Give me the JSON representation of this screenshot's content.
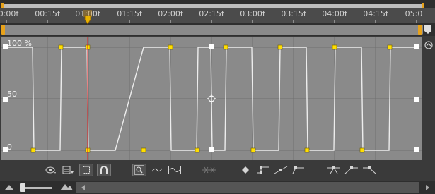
{
  "ruler": {
    "labels": [
      "0:00f",
      "00:15f",
      "01:00f",
      "01:15f",
      "02:00f",
      "02:15f",
      "03:00f",
      "03:15f",
      "04:00f",
      "04:15f",
      "05:0"
    ]
  },
  "graph": {
    "y_labels": {
      "top": "100 %",
      "mid": "50",
      "bottom": "0"
    },
    "colors": {
      "curve": "#e9e9e9",
      "keyframe": "#ffde00",
      "cti": "#e02020",
      "grid": "#6f6f6f",
      "background": "#8a8a8a"
    }
  },
  "toolbar": {
    "icons": [
      "eye-visibility-icon",
      "graph-type-options-icon",
      "transform-box-icon",
      "snap-magnet-icon",
      "fit-selection-icon",
      "fit-all-graphs-icon",
      "fit-all-icon",
      "separate-dimensions-icon",
      "edit-keyframe-icon",
      "convert-to-hold-icon",
      "convert-to-linear-icon",
      "convert-to-auto-bezier-icon",
      "easy-ease-icon",
      "easy-ease-in-icon",
      "easy-ease-out-icon"
    ]
  },
  "current_time_indicator": {
    "label": "01:00f"
  }
}
